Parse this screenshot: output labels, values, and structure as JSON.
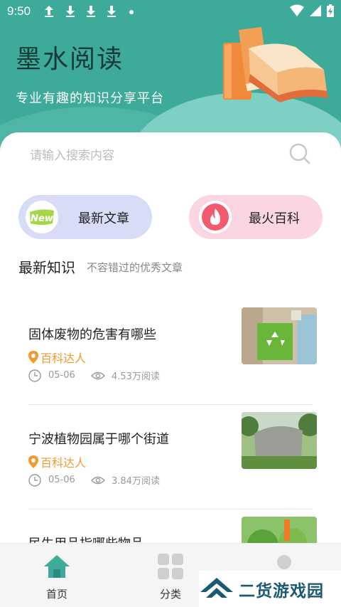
{
  "status_bar": {
    "time": "9:50"
  },
  "header": {
    "app_title": "墨水阅读",
    "subtitle": "专业有趣的知识分享平台"
  },
  "search": {
    "placeholder": "请输入搜索内容"
  },
  "quick_buttons": [
    {
      "label": "最新文章",
      "badge": "New"
    },
    {
      "label": "最火百科"
    }
  ],
  "section": {
    "title": "最新知识",
    "subtitle": "不容错过的优秀文章"
  },
  "articles": [
    {
      "title": "固体废物的危害有哪些",
      "author": "百科达人",
      "date": "05-06",
      "reads": "4.53万阅读"
    },
    {
      "title": "宁波植物园属于哪个街道",
      "author": "百科达人",
      "date": "05-06",
      "reads": "3.84万阅读"
    },
    {
      "title": "民生用品指哪些物品"
    }
  ],
  "tabbar": {
    "items": [
      {
        "label": "首页"
      },
      {
        "label": "分类"
      }
    ]
  },
  "watermark": {
    "text": "二货游戏园"
  },
  "colors": {
    "header": "#3daa9a",
    "accent": "#f39a2e",
    "new_button": "#d8dcf7",
    "hot_button": "#fbd6e2"
  }
}
